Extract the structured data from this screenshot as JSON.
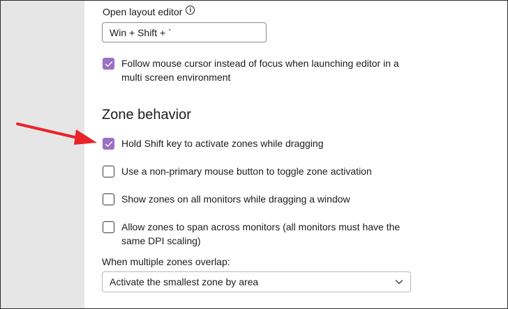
{
  "layout_editor": {
    "label": "Open layout editor",
    "hotkey_value": "Win + Shift + `"
  },
  "follow_cursor": {
    "label": "Follow mouse cursor instead of focus when launching editor in a multi screen environment",
    "checked": true
  },
  "zone_behavior": {
    "title": "Zone behavior",
    "options": [
      {
        "label": "Hold Shift key to activate zones while dragging",
        "checked": true
      },
      {
        "label": "Use a non-primary mouse button to toggle zone activation",
        "checked": false
      },
      {
        "label": "Show zones on all monitors while dragging a window",
        "checked": false
      },
      {
        "label": "Allow zones to span across monitors (all monitors must have the same DPI scaling)",
        "checked": false
      }
    ]
  },
  "overlap": {
    "label": "When multiple zones overlap:",
    "selected": "Activate the smallest zone by area"
  },
  "colors": {
    "accent": "#9b6fc4",
    "annotation_arrow": "#e8242a",
    "left_pane": "#e6e6e6"
  }
}
